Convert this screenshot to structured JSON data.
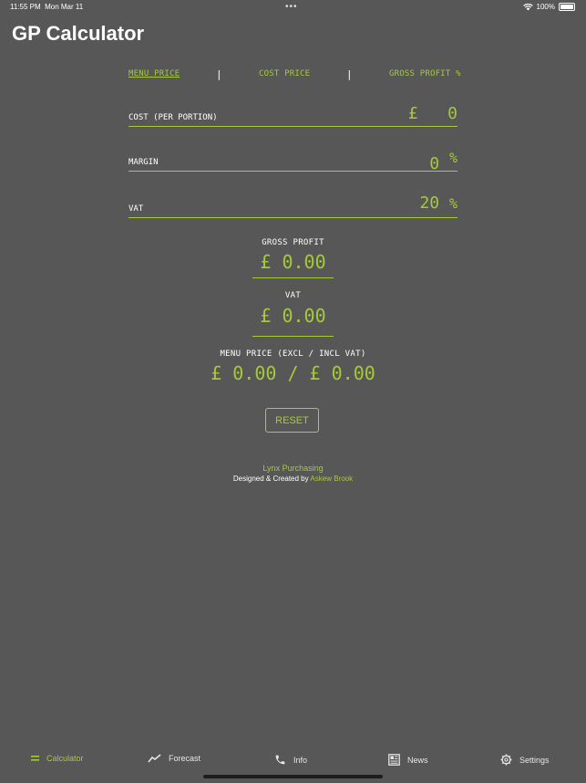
{
  "status_bar": {
    "time": "11:55 PM",
    "date": "Mon Mar 11",
    "battery": "100%"
  },
  "app": {
    "title": "GP Calculator"
  },
  "tabs": [
    {
      "label": "MENU PRICE"
    },
    {
      "label": "COST PRICE"
    },
    {
      "label": "GROSS PROFIT %"
    }
  ],
  "tab_separator": "|",
  "fields": {
    "cost": {
      "label": "COST (PER PORTION)",
      "currency": "£",
      "value": "0"
    },
    "margin": {
      "label": "MARGIN",
      "value": "0",
      "unit": "%"
    },
    "vat": {
      "label": "VAT",
      "value": "20",
      "unit": "%"
    }
  },
  "results": {
    "gross_profit": {
      "label": "GROSS PROFIT",
      "value": "£ 0.00"
    },
    "vat": {
      "label": "VAT",
      "value": "£ 0.00"
    },
    "menu_price": {
      "label": "MENU PRICE (EXCL / INCL VAT)",
      "value": "£ 0.00 / £ 0.00"
    }
  },
  "reset_label": "RESET",
  "footer": {
    "company": "Lynx Purchasing",
    "credit_prefix": "Designed & Created by",
    "credit_name": "Askew Brook"
  },
  "tabbar": [
    {
      "label": "Calculator",
      "icon": "calculator-icon",
      "active": true
    },
    {
      "label": "Forecast",
      "icon": "chart-line-icon",
      "active": false
    },
    {
      "label": "Info",
      "icon": "phone-icon",
      "active": false
    },
    {
      "label": "News",
      "icon": "newspaper-icon",
      "active": false
    },
    {
      "label": "Settings",
      "icon": "gear-icon",
      "active": false
    }
  ],
  "colors": {
    "background": "#575757",
    "accent": "#a6c93a",
    "text": "#ffffff"
  }
}
